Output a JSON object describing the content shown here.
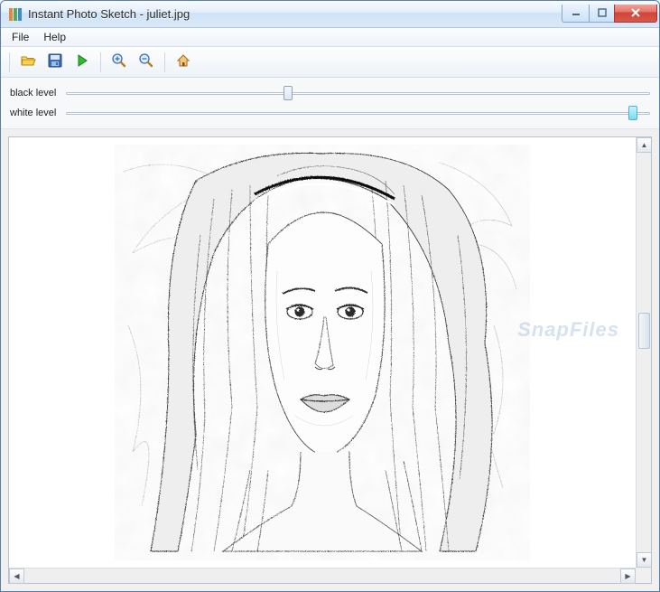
{
  "window": {
    "title": "Instant Photo Sketch - juliet.jpg"
  },
  "menubar": {
    "file": "File",
    "help": "Help"
  },
  "toolbar": {
    "open_icon": "open-folder-icon",
    "save_icon": "save-floppy-icon",
    "run_icon": "play-icon",
    "zoom_in_icon": "zoom-in-icon",
    "zoom_out_icon": "zoom-out-icon",
    "home_icon": "home-icon"
  },
  "sliders": {
    "black_label": "black level",
    "black_value_pct": 38,
    "white_label": "white level",
    "white_value_pct": 97
  },
  "canvas": {
    "watermark": "SnapFiles"
  }
}
